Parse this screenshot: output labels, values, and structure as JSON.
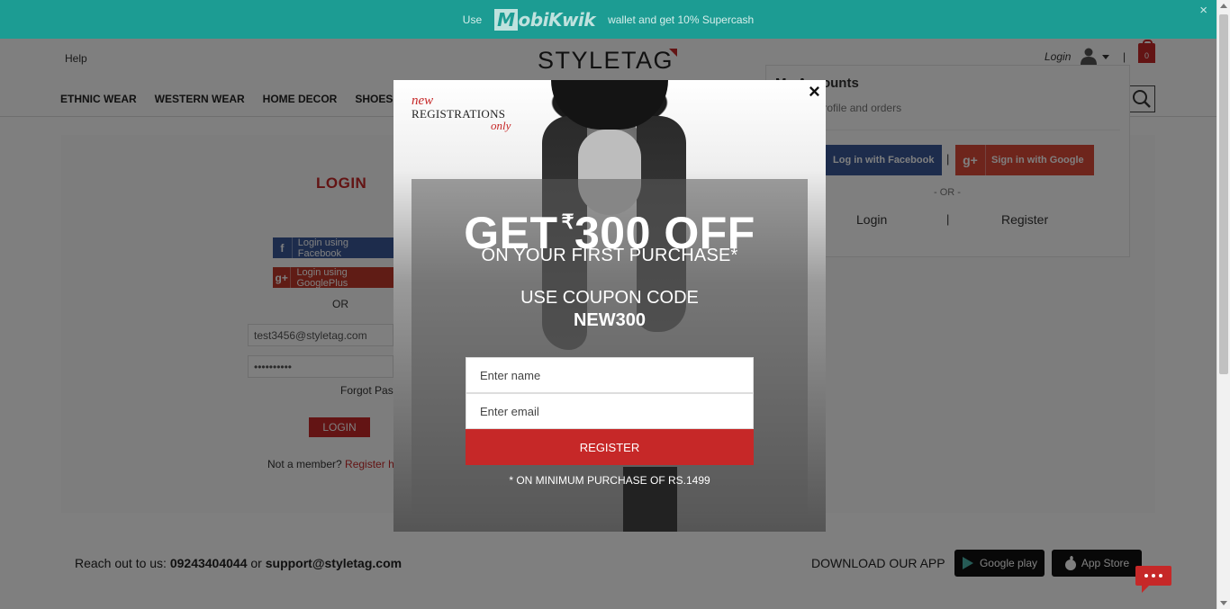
{
  "promo": {
    "prefix": "Use",
    "brand": "MobiKwik",
    "brand_tail": "obiKwik",
    "brand_initial": "M",
    "suffix": "wallet and get 10% Supercash",
    "close": "×"
  },
  "header": {
    "help": "Help",
    "logo": "STYLETAG",
    "login": "Login",
    "separator": "|",
    "cart_count": "0",
    "nav": [
      "ETHNIC WEAR",
      "WESTERN WEAR",
      "HOME DECOR",
      "SHOES"
    ]
  },
  "login_page": {
    "title": "LOGIN",
    "facebook": "Login using Facebook",
    "google": "Login using GooglePlus",
    "or": "OR",
    "email": "test3456@styletag.com",
    "password": "••••••••••",
    "forgot": "Forgot Password?",
    "login_button": "LOGIN",
    "not_member": "Not a member?",
    "register_here": "Register here"
  },
  "accounts": {
    "title": "My Accounts",
    "subtitle": "Manage profile and orders",
    "facebook": "Log in with Facebook",
    "google": "Sign in with Google",
    "or": "- OR -",
    "login": "Login",
    "separator": "|",
    "register": "Register"
  },
  "modal": {
    "new": "new",
    "registrations": "REGISTRATIONS",
    "only": "only",
    "close": "×",
    "get": "GET",
    "rupee": "₹",
    "amount": "300 OFF",
    "first_purchase": "ON YOUR FIRST PURCHASE*",
    "coupon_label": "USE COUPON CODE",
    "coupon_code": "NEW300",
    "name_placeholder": "Enter name",
    "email_placeholder": "Enter email",
    "register_button": "REGISTER",
    "minimum": "* ON MINIMUM PURCHASE OF RS.1499"
  },
  "footer": {
    "reach_prefix": "Reach out to us:",
    "phone": "09243404044",
    "or": "or",
    "email": "support@styletag.com",
    "download": "DOWNLOAD OUR APP",
    "google_play": "Google play",
    "app_store": "App Store"
  },
  "colors": {
    "accent": "#c62828",
    "promo_bg": "#1c9c93",
    "facebook": "#3b5998",
    "google": "#dd4b39"
  }
}
